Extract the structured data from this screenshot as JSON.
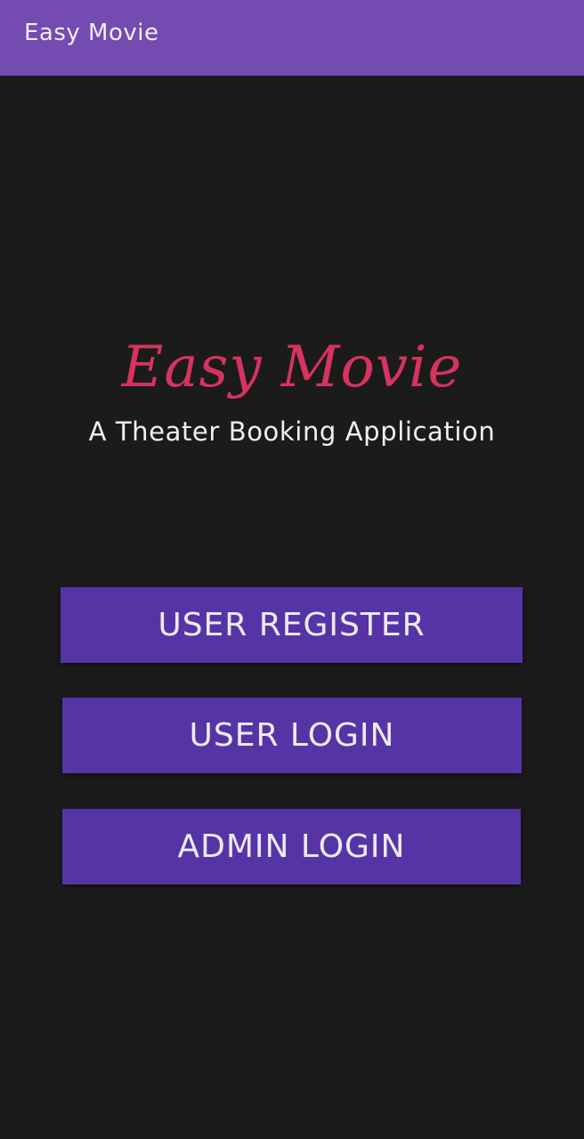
{
  "app_bar": {
    "title": "Easy Movie"
  },
  "hero": {
    "title": "Easy Movie",
    "subtitle": "A Theater Booking Application"
  },
  "buttons": {
    "register": "USER REGISTER",
    "user_login": "USER LOGIN",
    "admin_login": "ADMIN LOGIN"
  },
  "colors": {
    "app_bar": "#744bb1",
    "background": "#1b1b1b",
    "accent": "#d7335f",
    "button": "#5734a6",
    "button_text": "#ecebf3"
  }
}
